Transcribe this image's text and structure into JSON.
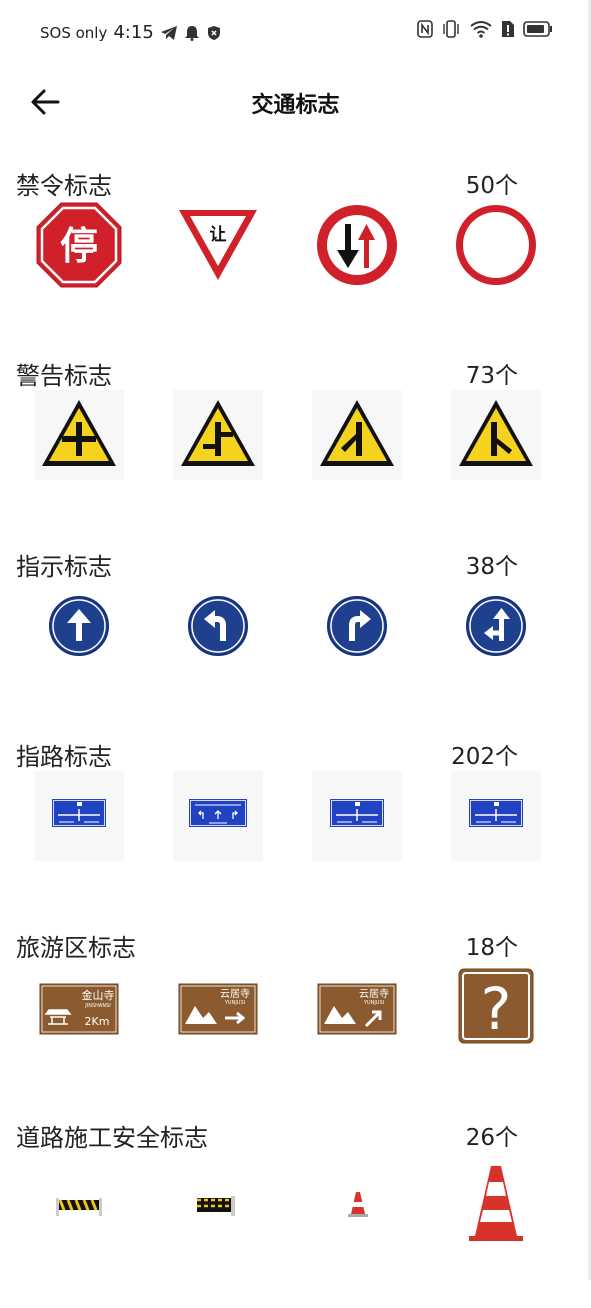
{
  "status_bar": {
    "carrier": "SOS only",
    "time": "4:15"
  },
  "app_bar": {
    "title": "交通标志",
    "back_icon": "arrow-left-icon"
  },
  "sections": [
    {
      "title": "禁令标志",
      "count": "50个",
      "signs": [
        "stop-sign-icon",
        "yield-sign-icon",
        "oncoming-priority-sign-icon",
        "no-vehicles-sign-icon"
      ],
      "sign_text": {
        "stop": "停",
        "yield": "让"
      }
    },
    {
      "title": "警告标志",
      "count": "73个",
      "signs": [
        "crossroad-warning-icon",
        "staggered-junction-warning-icon",
        "side-road-left-warning-icon",
        "side-road-right-warning-icon"
      ]
    },
    {
      "title": "指示标志",
      "count": "38个",
      "signs": [
        "straight-ahead-sign-icon",
        "turn-left-sign-icon",
        "turn-right-sign-icon",
        "straight-or-left-sign-icon"
      ]
    },
    {
      "title": "指路标志",
      "count": "202个",
      "signs": [
        "direction-board-icon",
        "direction-board-icon",
        "direction-board-icon",
        "direction-board-icon"
      ]
    },
    {
      "title": "旅游区标志",
      "count": "18个",
      "signs": [
        "tourist-sign-icon",
        "tourist-sign-icon",
        "tourist-sign-icon",
        "question-mark-sign-icon"
      ],
      "sign_text": {
        "jinshan": "金山寺",
        "jinshan_py": "JINSHANSI",
        "dist": "2Km",
        "yunju": "云居寺",
        "yunju_py": "YUNJUSI",
        "question": "?"
      }
    },
    {
      "title": "道路施工安全标志",
      "count": "26个",
      "signs": [
        "barrier-icon",
        "barrier-icon",
        "traffic-cone-icon",
        "traffic-cone-icon"
      ]
    }
  ],
  "colors": {
    "prohibition_red": "#d0202a",
    "warning_yellow": "#f5d21d",
    "indication_blue": "#1f3f8f",
    "guide_blue": "#2142c2",
    "tourist_brown": "#8b5a2e",
    "cone_red": "#d8332a"
  }
}
